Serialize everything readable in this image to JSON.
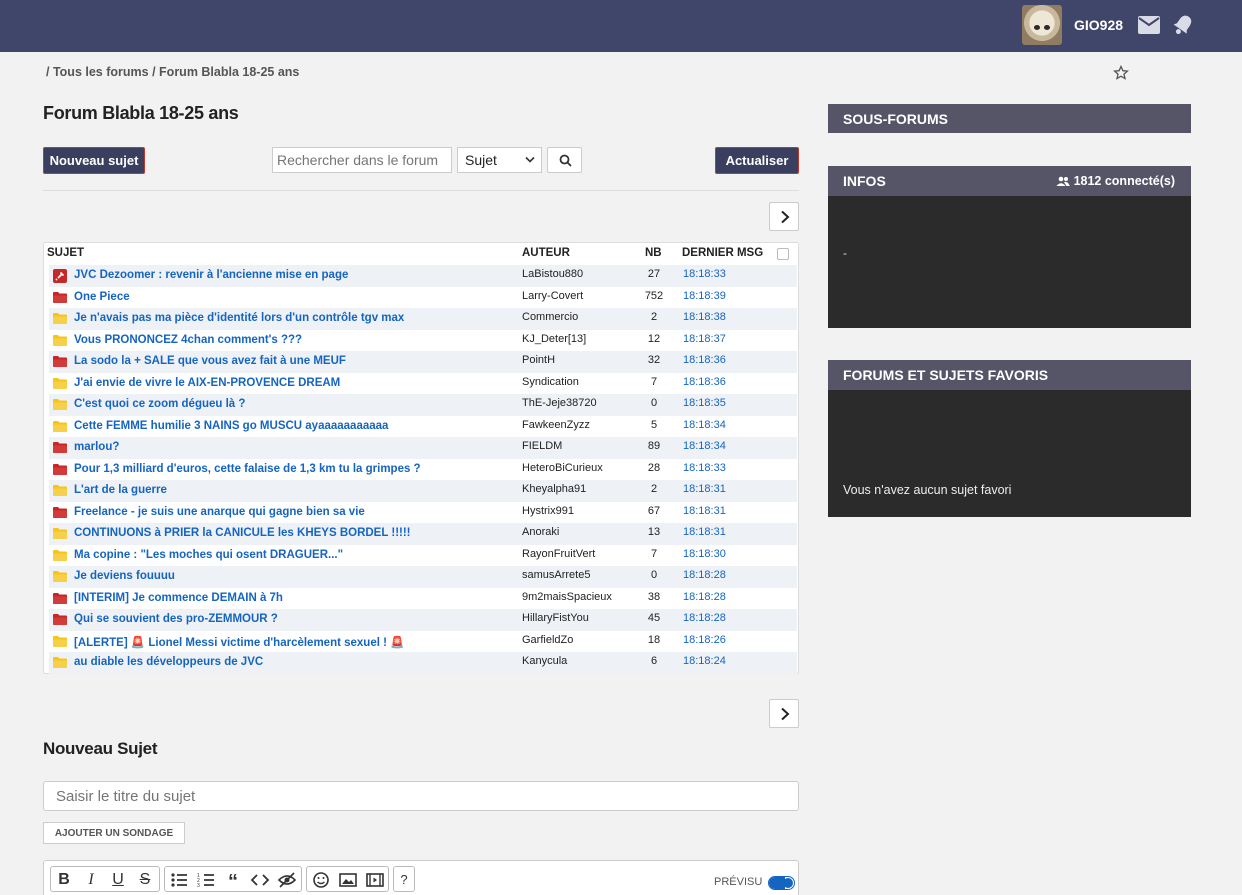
{
  "header": {
    "username": "GIO928"
  },
  "breadcrumb": {
    "sep1": "/",
    "all_forums": "Tous les forums",
    "sep2": "/",
    "current": "Forum Blabla 18-25 ans"
  },
  "forum_title": "Forum Blabla 18-25 ans",
  "toolbar": {
    "new_topic_label": "Nouveau sujet",
    "search_placeholder": "Rechercher dans le forum",
    "search_scope": "Sujet",
    "refresh_label": "Actualiser"
  },
  "table": {
    "headers": {
      "subject": "SUJET",
      "author": "AUTEUR",
      "count": "NB",
      "last": "DERNIER MSG"
    },
    "rows": [
      {
        "icon": "pinned",
        "title": "JVC Dezoomer : revenir à l'ancienne mise en page",
        "author": "LaBistou880",
        "count": "27",
        "time": "18:18:33"
      },
      {
        "icon": "folder-red",
        "title": "One Piece",
        "author": "Larry-Covert",
        "count": "752",
        "time": "18:18:39"
      },
      {
        "icon": "folder-yellow",
        "title": "Je n'avais pas ma pièce d'identité lors d'un contrôle tgv max",
        "author": "Commercio",
        "count": "2",
        "time": "18:18:38"
      },
      {
        "icon": "folder-yellow",
        "title": "Vous PRONONCEZ 4chan comment's ???",
        "author": "KJ_Deter[13]",
        "count": "12",
        "time": "18:18:37"
      },
      {
        "icon": "folder-red",
        "title": "La sodo la + SALE que vous avez fait à une MEUF",
        "author": "PointH",
        "count": "32",
        "time": "18:18:36"
      },
      {
        "icon": "folder-yellow",
        "title": "J'ai envie de vivre le AIX-EN-PROVENCE DREAM",
        "author": "Syndication",
        "count": "7",
        "time": "18:18:36"
      },
      {
        "icon": "folder-yellow",
        "title": "C'est quoi ce zoom dégueu là ?",
        "author": "ThE-Jeje38720",
        "count": "0",
        "time": "18:18:35"
      },
      {
        "icon": "folder-yellow",
        "title": "Cette FEMME humilie 3 NAINS go MUSCU ayaaaaaaaaaaa",
        "author": "FawkeenZyzz",
        "count": "5",
        "time": "18:18:34"
      },
      {
        "icon": "folder-red",
        "title": "marlou?",
        "author": "FIELDM",
        "count": "89",
        "time": "18:18:34"
      },
      {
        "icon": "folder-red",
        "title": "Pour 1,3 milliard d'euros, cette falaise de 1,3 km tu la grimpes ?",
        "author": "HeteroBiCurieux",
        "count": "28",
        "time": "18:18:33"
      },
      {
        "icon": "folder-yellow",
        "title": "L'art de la guerre",
        "author": "Kheyalpha91",
        "count": "2",
        "time": "18:18:31"
      },
      {
        "icon": "folder-red",
        "title": "Freelance - je suis une anarque qui gagne bien sa vie",
        "author": "Hystrix991",
        "count": "67",
        "time": "18:18:31"
      },
      {
        "icon": "folder-yellow",
        "title": "CONTINUONS à PRIER la CANICULE les KHEYS BORDEL !!!!!",
        "author": "Anoraki",
        "count": "13",
        "time": "18:18:31"
      },
      {
        "icon": "folder-yellow",
        "title": "Ma copine : \"Les moches qui osent DRAGUER...\"",
        "author": "RayonFruitVert",
        "count": "7",
        "time": "18:18:30"
      },
      {
        "icon": "folder-yellow",
        "title": "Je deviens fouuuu",
        "author": "samusArrete5",
        "count": "0",
        "time": "18:18:28"
      },
      {
        "icon": "folder-red",
        "title": "[INTERIM] Je commence DEMAIN à 7h",
        "author": "9m2maisSpacieux",
        "count": "38",
        "time": "18:18:28"
      },
      {
        "icon": "folder-red",
        "title": "Qui se souvient des pro-ZEMMOUR ?",
        "author": "HillaryFistYou",
        "count": "45",
        "time": "18:18:28"
      },
      {
        "icon": "folder-yellow",
        "title": "[ALERTE] 🚨 Lionel Messi victime d'harcèlement sexuel ! 🚨",
        "author": "GarfieldZo",
        "count": "18",
        "time": "18:18:26"
      },
      {
        "icon": "folder-yellow",
        "title": "au diable les développeurs de JVC",
        "author": "Kanycula",
        "count": "6",
        "time": "18:18:24"
      }
    ]
  },
  "new_topic": {
    "heading": "Nouveau Sujet",
    "title_placeholder": "Saisir le titre du sujet",
    "poll_label": "AJOUTER UN SONDAGE",
    "preview_label": "PRÉVISU"
  },
  "sidebar": {
    "sub_forums": "SOUS-FORUMS",
    "infos": "INFOS",
    "connected": "1812 connecté(s)",
    "infos_text": "-",
    "favorites": "FORUMS ET SUJETS FAVORIS",
    "favorites_empty": "Vous n'avez aucun sujet favori"
  },
  "colors": {
    "header_bg": "#40456a",
    "panel_head": "#565568",
    "panel_body": "#2b2b2b",
    "link": "#1565c0",
    "folder_yellow": "#f5c518",
    "folder_red": "#c62828"
  }
}
